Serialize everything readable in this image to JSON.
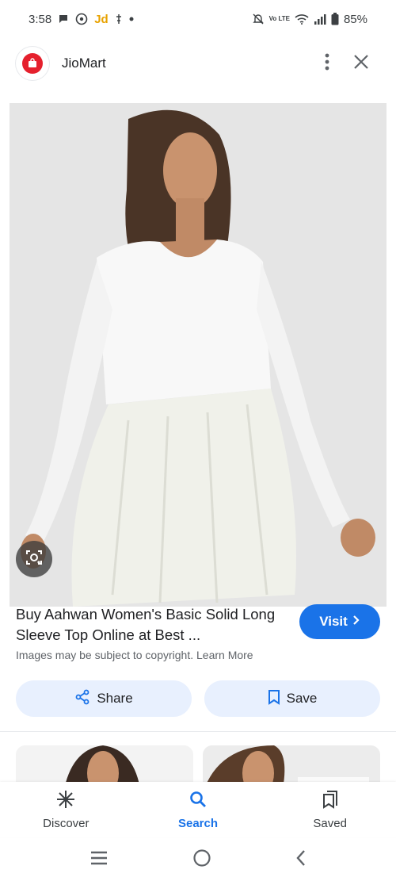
{
  "status_bar": {
    "time": "3:58",
    "jd_label": "Jd",
    "battery": "85%",
    "network": "Vo LTE"
  },
  "header": {
    "site_name": "JioMart",
    "icons": [
      "more-vert-icon",
      "close-icon"
    ]
  },
  "result": {
    "title": "Buy Aahwan Women's Basic Solid Long Sleeve Top Online at Best ...",
    "visit_label": "Visit",
    "copyright_text": "Images may be subject to copyright. Learn More"
  },
  "actions": {
    "share_label": "Share",
    "save_label": "Save"
  },
  "bottom_nav": {
    "items": [
      {
        "label": "Discover",
        "icon": "asterisk-icon"
      },
      {
        "label": "Search",
        "icon": "search-icon",
        "active": true
      },
      {
        "label": "Saved",
        "icon": "saved-icon"
      }
    ]
  },
  "colors": {
    "accent": "#1a73e8",
    "button_bg": "#e8f0fe",
    "brand_red": "#e5202d"
  }
}
